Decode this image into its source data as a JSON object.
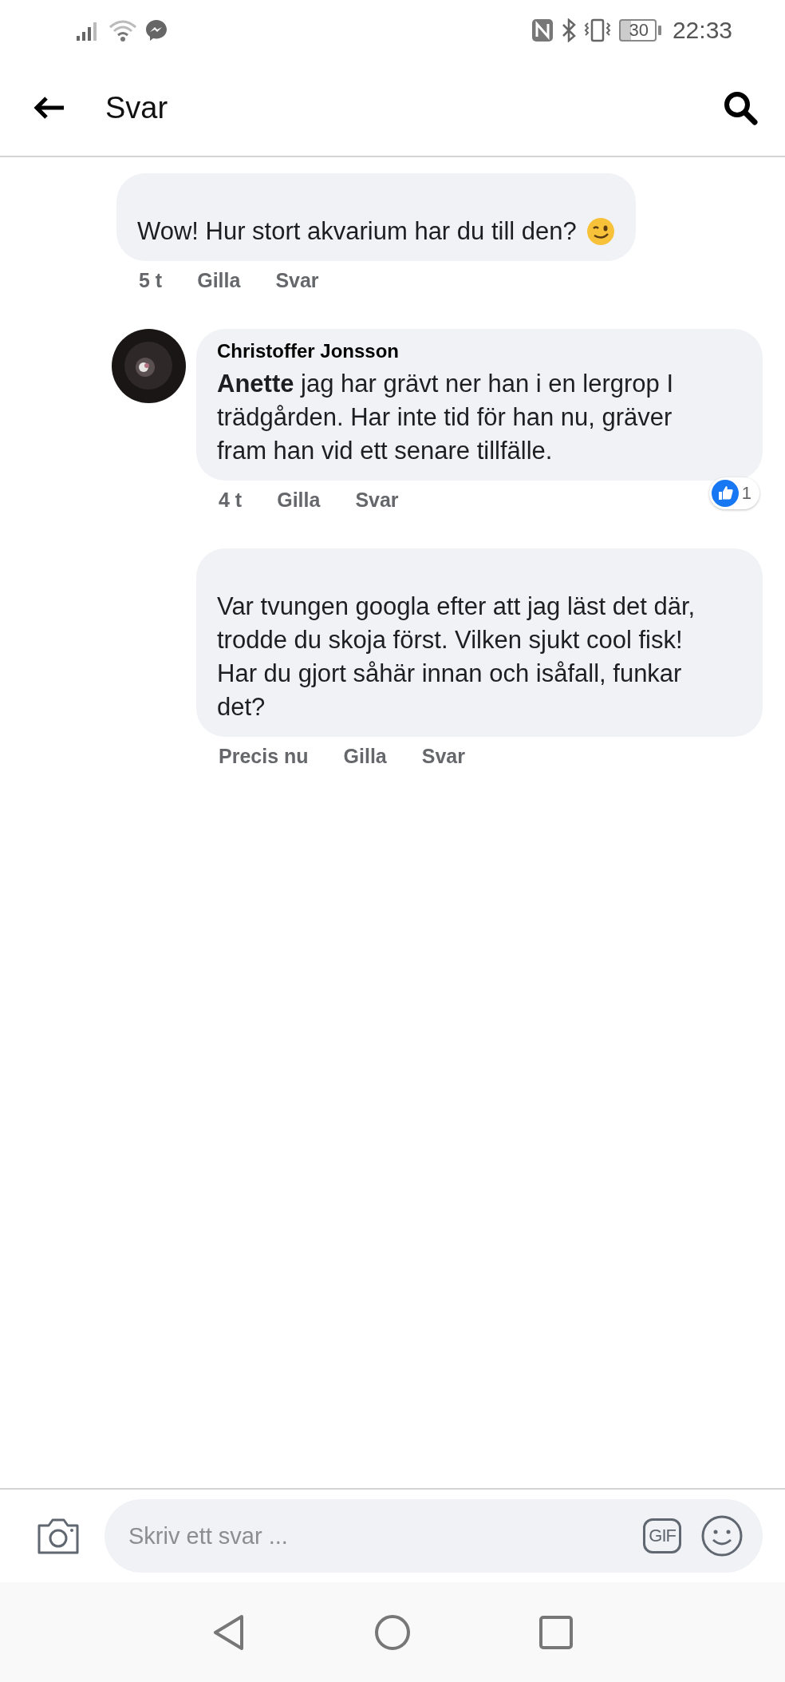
{
  "status_bar": {
    "battery": "30",
    "time": "22:33"
  },
  "header": {
    "title": "Svar"
  },
  "comments": [
    {
      "nested": false,
      "author_visible": false,
      "text": "Wow! Hur stort akvarium har du till den?",
      "trailing_emoji": true,
      "time": "5 t",
      "actions": [
        "Gilla",
        "Svar"
      ]
    },
    {
      "nested": true,
      "avatar": {
        "kind": "picture"
      },
      "author_visible": true,
      "author": "Christoffer Jonsson",
      "text": "**Anette** jag har grävt ner han i en lergrop I trädgården. Har inte tid för han nu, gräver fram han vid ett senare tillfälle.",
      "trailing_emoji": false,
      "time": "4 t",
      "actions": [
        "Gilla",
        "Svar"
      ],
      "reaction": {
        "count": "1"
      }
    },
    {
      "nested": true,
      "author_visible": false,
      "text": "Var tvungen googla efter att jag läst det där, trodde du skoja först. Vilken sjukt cool fisk! Har du gjort såhär innan och isåfall, funkar det?",
      "trailing_emoji": false,
      "time": "Precis nu",
      "actions": [
        "Gilla",
        "Svar"
      ]
    }
  ],
  "composer": {
    "placeholder": "Skriv ett svar ...",
    "gif_label": "GIF"
  }
}
